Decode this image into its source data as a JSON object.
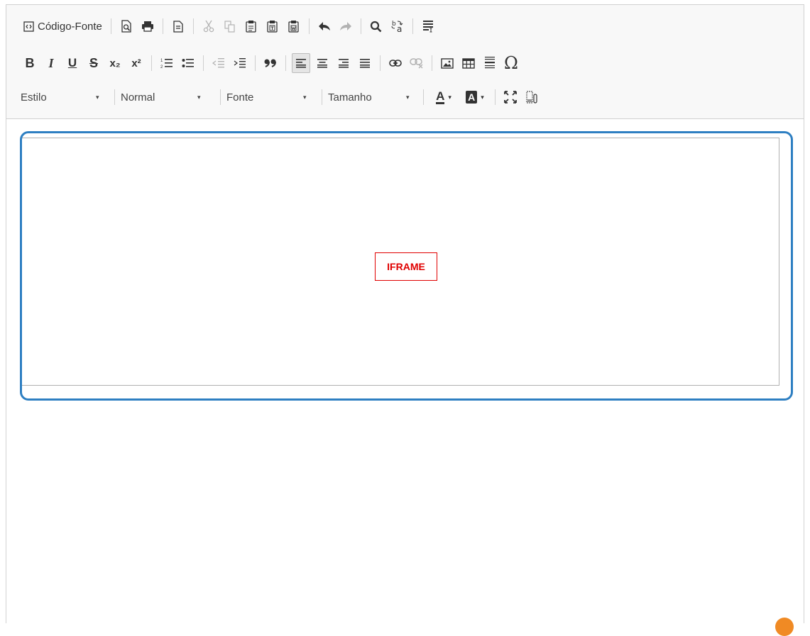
{
  "toolbar": {
    "row1": {
      "source_label": "Código-Fonte",
      "icons": [
        "source-icon",
        "preview-icon",
        "print-icon",
        "templates-icon",
        "cut-icon",
        "copy-icon",
        "paste-icon",
        "paste-text-icon",
        "paste-word-icon",
        "undo-icon",
        "redo-icon",
        "find-icon",
        "replace-icon",
        "select-all-icon"
      ]
    },
    "row2": {
      "bold": "B",
      "italic": "I",
      "underline": "U",
      "strike": "S",
      "subscript": "x₂",
      "superscript": "x²",
      "special_char": "Ω"
    },
    "row3": {
      "style_combo": "Estilo",
      "format_combo": "Normal",
      "font_combo": "Fonte",
      "size_combo": "Tamanho",
      "text_color": "A",
      "bg_color": "A",
      "dropdown_arrow": "▾"
    }
  },
  "content": {
    "iframe_label": "IFRAME"
  },
  "colors": {
    "accent": "#2e7fc2",
    "iframe_label": "#e00000",
    "notification": "#f08a24"
  }
}
